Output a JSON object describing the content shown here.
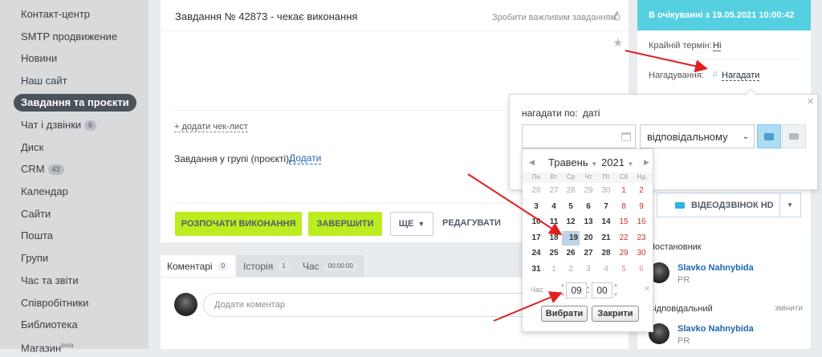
{
  "sidebar": {
    "items": [
      {
        "label": "Контакт-центр"
      },
      {
        "label": "SMTP продвижение"
      },
      {
        "label": "Новини"
      },
      {
        "label": "Наш сайт"
      },
      {
        "label": "Завдання та проєкти"
      },
      {
        "label": "Чат і дзвінки",
        "badge": "6"
      },
      {
        "label": "Диск"
      },
      {
        "label": "CRM",
        "badge": "43"
      },
      {
        "label": "Календар"
      },
      {
        "label": "Сайти"
      },
      {
        "label": "Пошта"
      },
      {
        "label": "Групи"
      },
      {
        "label": "Час та звіти"
      },
      {
        "label": "Співробітники"
      },
      {
        "label": "Библиотека"
      },
      {
        "label": "Магазин",
        "sup": "beta"
      }
    ]
  },
  "task": {
    "title": "Завдання № 42873 - чекає виконання",
    "important": "Зробити важливим завданням",
    "checklist": "+ додати чек-лист",
    "group_label": "Завдання у групі (проєкті):",
    "group_add": "Додати",
    "actions": {
      "start": "РОЗПОЧАТИ ВИКОНАННЯ",
      "finish": "ЗАВЕРШИТИ",
      "more": "ЩЕ",
      "edit": "РЕДАГУВАТИ"
    }
  },
  "tabs": [
    {
      "label": "Коментарі",
      "badge": "0"
    },
    {
      "label": "Історія",
      "badge": "1"
    },
    {
      "label": "Час",
      "badge": "00:00:00"
    }
  ],
  "comment": {
    "placeholder": "Додати коментар"
  },
  "right": {
    "status": "В очікуванні з 19.05.2021 10:00:42",
    "deadline_label": "Крайній термін:",
    "deadline_value": "Ні",
    "reminder_label": "Нагадування:",
    "reminder_value": "Нагадати",
    "video": "ВІДЕОДЗВІНОК HD",
    "creator_label": "Постановник",
    "responsible_label": "Відповідальний",
    "change": "змінити",
    "creator": {
      "name": "Slavko Nahnybida",
      "role": "PR"
    },
    "responsible": {
      "name": "Slavko Nahnybida",
      "role": "PR"
    }
  },
  "reminder_popup": {
    "label": "нагадати по:",
    "mode": "даті",
    "recipient": "відповідальному"
  },
  "calendar": {
    "month": "Травень",
    "year": "2021",
    "weekdays": [
      "Пн",
      "Вт",
      "Ср",
      "Чт",
      "Пт",
      "Сб",
      "Нд"
    ],
    "weeks": [
      [
        "26",
        "27",
        "28",
        "29",
        "30",
        "1",
        "2"
      ],
      [
        "3",
        "4",
        "5",
        "6",
        "7",
        "8",
        "9"
      ],
      [
        "10",
        "11",
        "12",
        "13",
        "14",
        "15",
        "16"
      ],
      [
        "17",
        "18",
        "19",
        "20",
        "21",
        "22",
        "23"
      ],
      [
        "24",
        "25",
        "26",
        "27",
        "28",
        "29",
        "30"
      ],
      [
        "31",
        "1",
        "2",
        "3",
        "4",
        "5",
        "6"
      ]
    ],
    "selected_day": "19",
    "time_label": "Час",
    "hour": "09",
    "minute": "00",
    "choose": "Вибрати",
    "close": "Закрити"
  },
  "colors": {
    "accent_green": "#bbed21",
    "status_cyan": "#55d0e0",
    "link_blue": "#2067b0",
    "arrow_red": "#e02020"
  }
}
